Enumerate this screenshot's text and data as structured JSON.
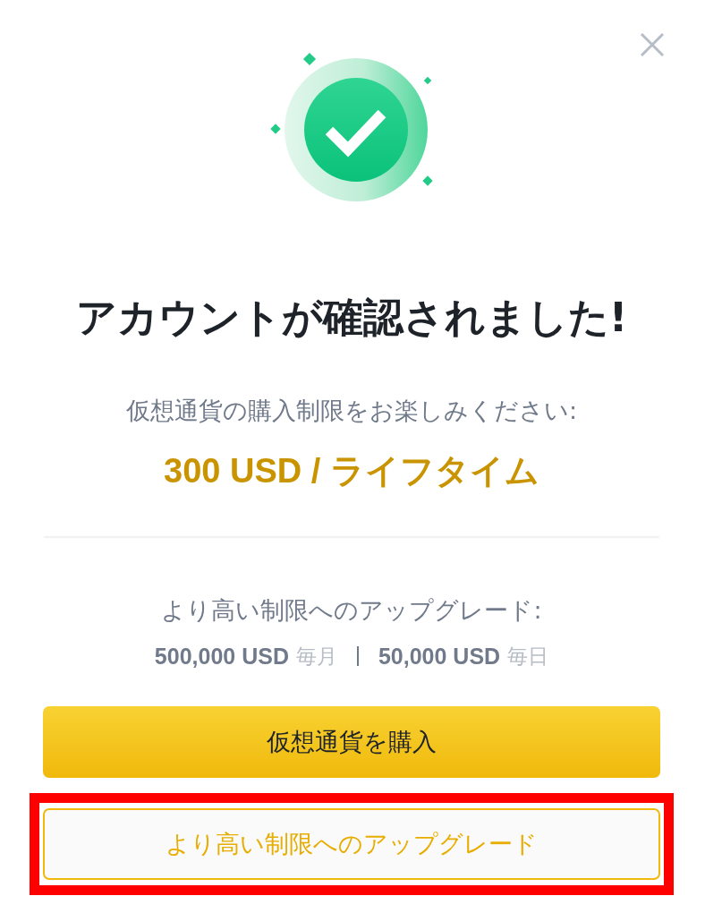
{
  "title": "アカウントが確認されました!",
  "current_limit": {
    "caption": "仮想通貨の購入制限をお楽しみください:",
    "value": "300 USD / ライフタイム"
  },
  "upgrade": {
    "caption": "より高い制限へのアップグレード:",
    "limits": [
      {
        "amount": "500,000 USD",
        "period": "毎月"
      },
      {
        "amount": "50,000 USD",
        "period": "毎日"
      }
    ]
  },
  "buttons": [
    {
      "label": "仮想通貨を購入",
      "kind": "primary",
      "highlighted": false
    },
    {
      "label": "より高い制限へのアップグレード",
      "kind": "secondary",
      "highlighted": true
    }
  ]
}
